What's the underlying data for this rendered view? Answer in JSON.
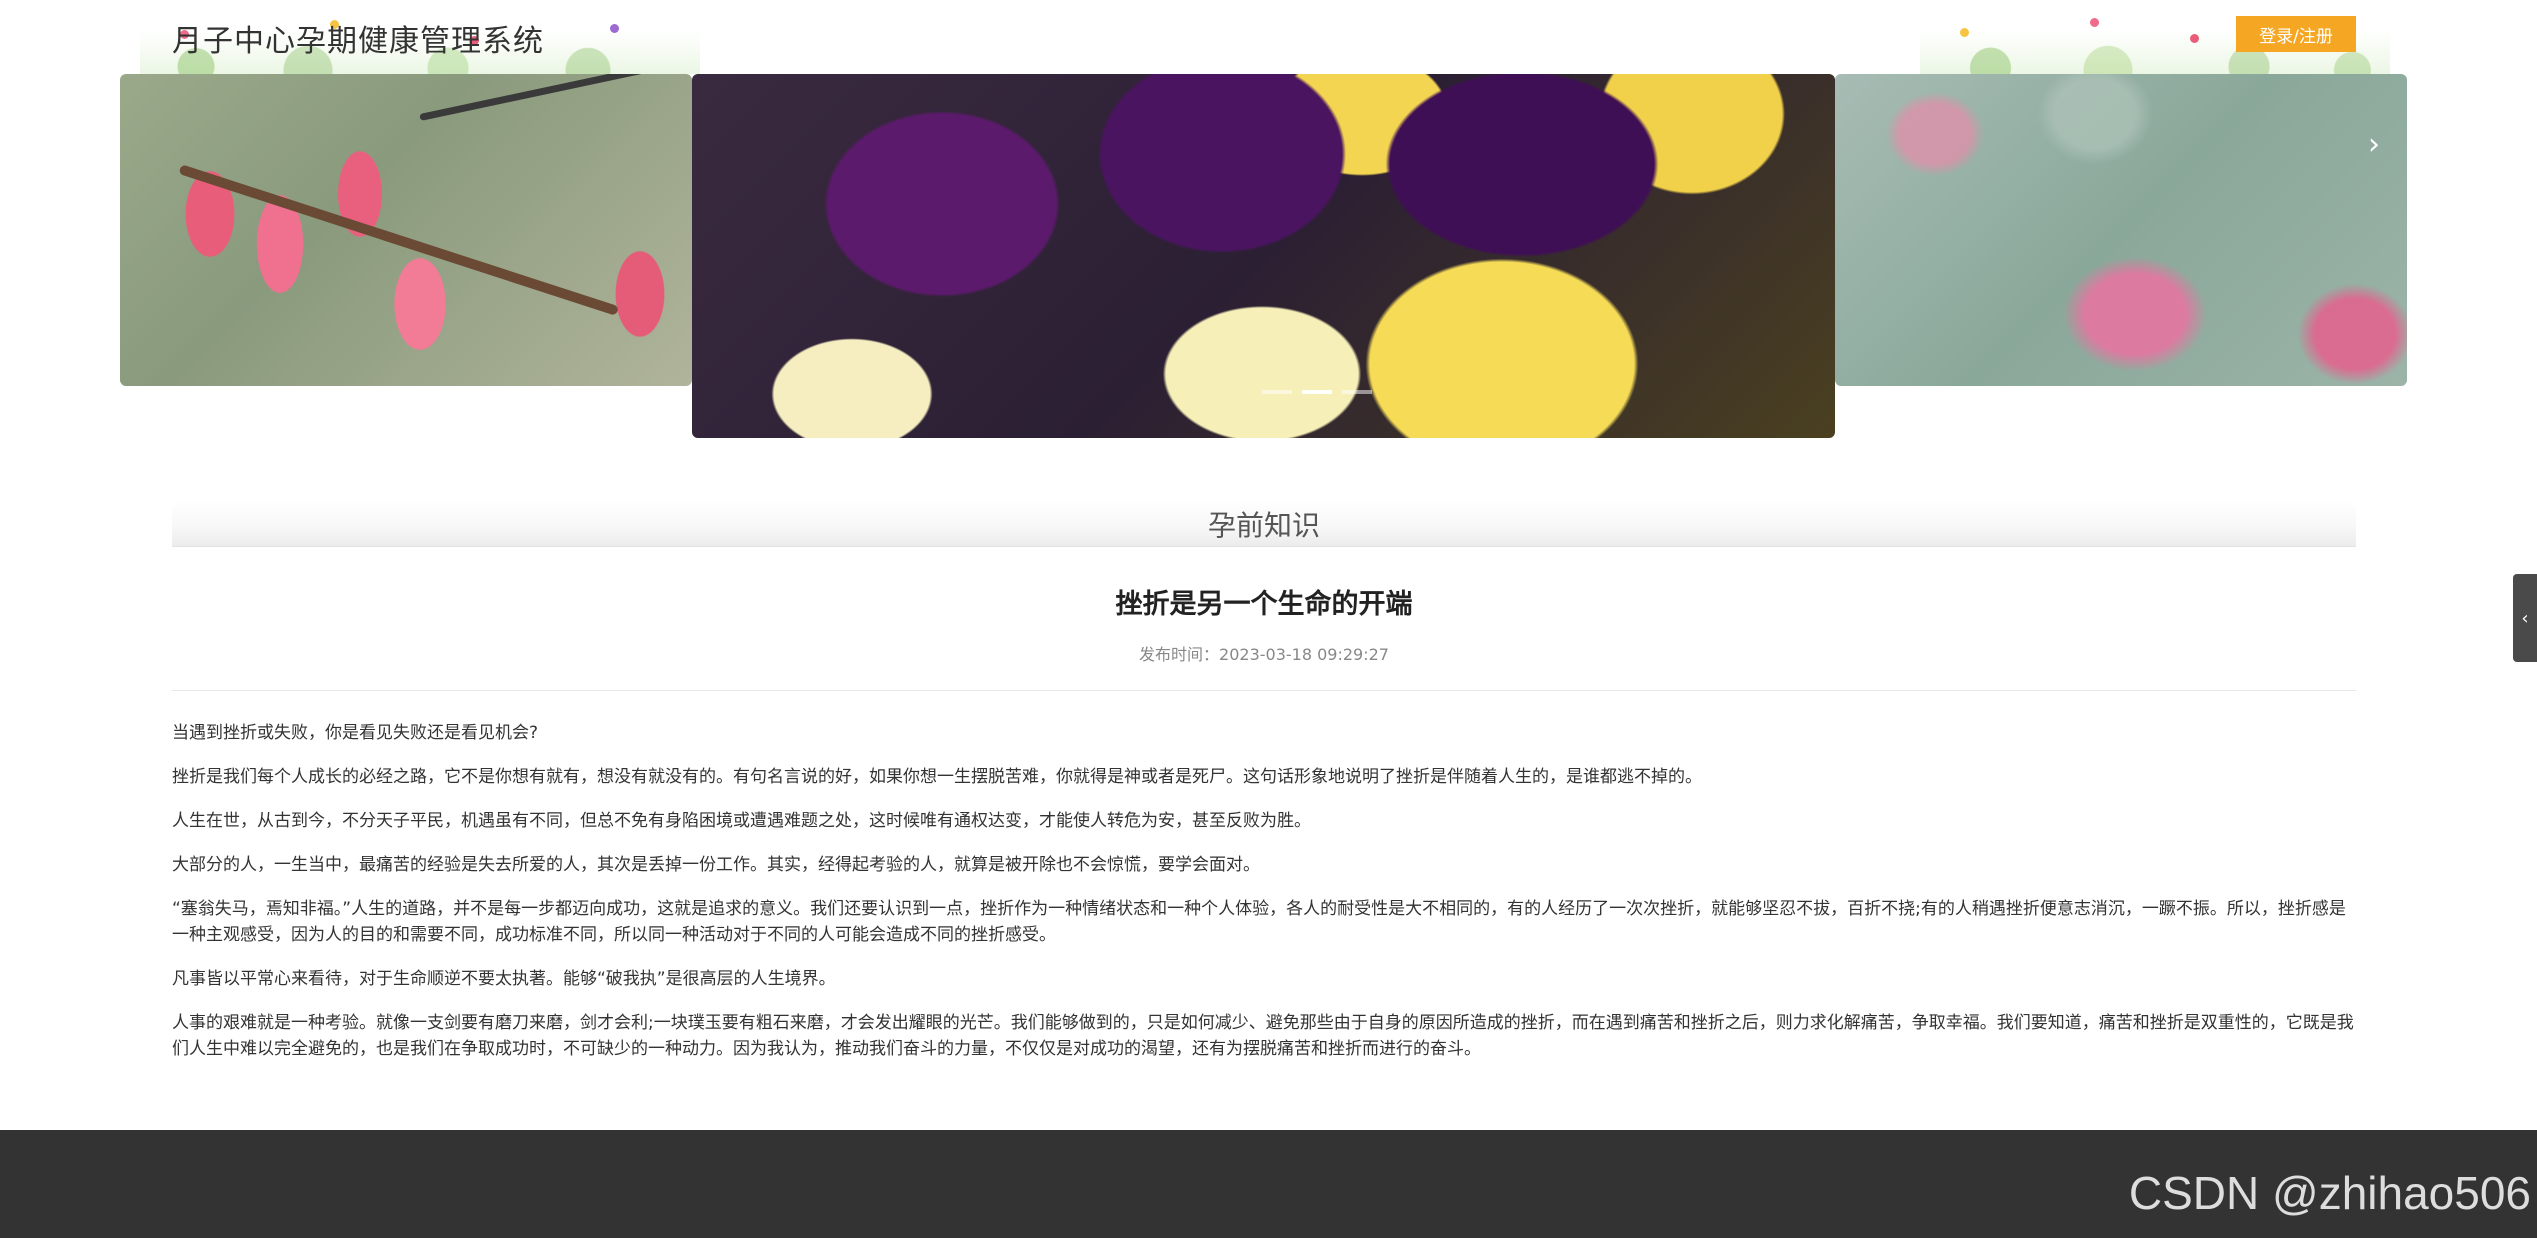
{
  "header": {
    "title": "月子中心孕期健康管理系统",
    "login_label": "登录/注册"
  },
  "carousel": {
    "next_icon": "chevron-right-icon",
    "next_glyph": "›",
    "slides": [
      "slide-left",
      "slide-center",
      "slide-right"
    ],
    "active_index": 1
  },
  "section": {
    "title": "孕前知识"
  },
  "article": {
    "title": "挫折是另一个生命的开端",
    "publish_time": "发布时间：2023-03-18 09:29:27",
    "paragraphs": [
      "当遇到挫折或失败，你是看见失败还是看见机会?",
      "挫折是我们每个人成长的必经之路，它不是你想有就有，想没有就没有的。有句名言说的好，如果你想一生摆脱苦难，你就得是神或者是死尸。这句话形象地说明了挫折是伴随着人生的，是谁都逃不掉的。",
      "人生在世，从古到今，不分天子平民，机遇虽有不同，但总不免有身陷困境或遭遇难题之处，这时候唯有通权达变，才能使人转危为安，甚至反败为胜。",
      "大部分的人，一生当中，最痛苦的经验是失去所爱的人，其次是丢掉一份工作。其实，经得起考验的人，就算是被开除也不会惊慌，要学会面对。",
      "“塞翁失马，焉知非福。”人生的道路，并不是每一步都迈向成功，这就是追求的意义。我们还要认识到一点，挫折作为一种情绪状态和一种个人体验，各人的耐受性是大不相同的，有的人经历了一次次挫折，就能够坚忍不拔，百折不挠;有的人稍遇挫折便意志消沉，一蹶不振。所以，挫折感是一种主观感受，因为人的目的和需要不同，成功标准不同，所以同一种活动对于不同的人可能会造成不同的挫折感受。",
      "凡事皆以平常心来看待，对于生命顺逆不要太执著。能够“破我执”是很高层的人生境界。",
      "人事的艰难就是一种考验。就像一支剑要有磨刀来磨，剑才会利;一块璞玉要有粗石来磨，才会发出耀眼的光芒。我们能够做到的，只是如何减少、避免那些由于自身的原因所造成的挫折，而在遇到痛苦和挫折之后，则力求化解痛苦，争取幸福。我们要知道，痛苦和挫折是双重性的，它既是我们人生中难以完全避免的，也是我们在争取成功时，不可缺少的一种动力。因为我认为，推动我们奋斗的力量，不仅仅是对成功的渴望，还有为摆脱痛苦和挫折而进行的奋斗。"
    ]
  },
  "side_tab": {
    "icon": "chevron-left-icon",
    "glyph": "‹"
  },
  "footer": {
    "watermark": "CSDN @zhihao506"
  },
  "colors": {
    "accent": "#f5a623",
    "footer_bg": "#333333",
    "side_tab_bg": "#4a4a4a"
  }
}
